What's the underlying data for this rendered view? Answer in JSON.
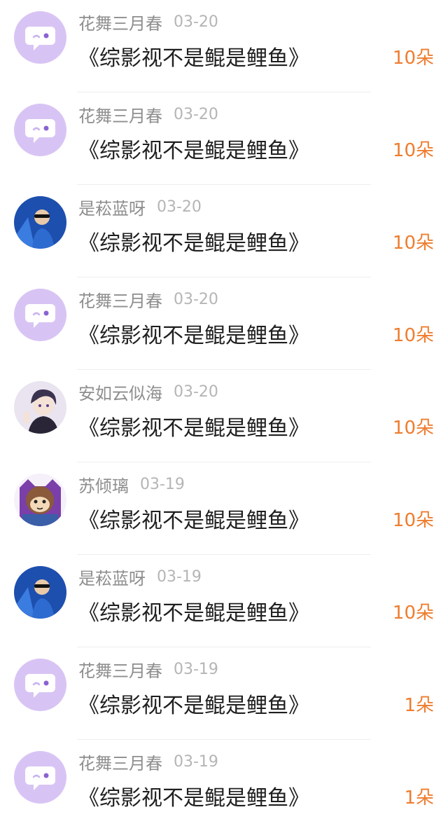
{
  "gift_records": [
    {
      "user": "花舞三月春",
      "date": "03-20",
      "book": "《综影视不是鲲是鲤鱼》",
      "amount": "10朵",
      "avatar": "default-avatar"
    },
    {
      "user": "花舞三月春",
      "date": "03-20",
      "book": "《综影视不是鲲是鲤鱼》",
      "amount": "10朵",
      "avatar": "default-avatar"
    },
    {
      "user": "是菘蓝呀",
      "date": "03-20",
      "book": "《综影视不是鲲是鲤鱼》",
      "amount": "10朵",
      "avatar": "blue-photo-avatar"
    },
    {
      "user": "花舞三月春",
      "date": "03-20",
      "book": "《综影视不是鲲是鲤鱼》",
      "amount": "10朵",
      "avatar": "default-avatar"
    },
    {
      "user": "安如云似海",
      "date": "03-20",
      "book": "《综影视不是鲲是鲤鱼》",
      "amount": "10朵",
      "avatar": "anime-boy-avatar"
    },
    {
      "user": "苏倾璃",
      "date": "03-19",
      "book": "《综影视不是鲲是鲤鱼》",
      "amount": "10朵",
      "avatar": "cartoon-character-avatar"
    },
    {
      "user": "是菘蓝呀",
      "date": "03-19",
      "book": "《综影视不是鲲是鲤鱼》",
      "amount": "10朵",
      "avatar": "blue-photo-avatar"
    },
    {
      "user": "花舞三月春",
      "date": "03-19",
      "book": "《综影视不是鲲是鲤鱼》",
      "amount": "1朵",
      "avatar": "default-avatar"
    },
    {
      "user": "花舞三月春",
      "date": "03-19",
      "book": "《综影视不是鲲是鲤鱼》",
      "amount": "1朵",
      "avatar": "default-avatar"
    }
  ],
  "colors": {
    "amount": "#ee7d2f",
    "username": "#8e8e8e",
    "date": "#b5b5b5",
    "book_title": "#1f1f1f",
    "default_avatar_bg": "#d8c4f4"
  }
}
